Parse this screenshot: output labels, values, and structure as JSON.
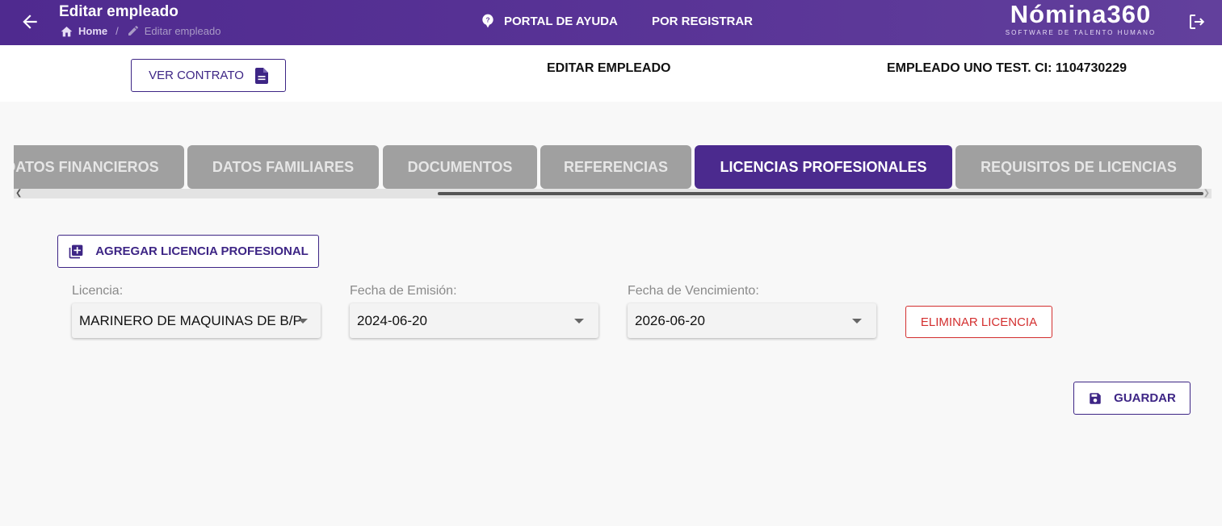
{
  "topbar": {
    "title": "Editar empleado",
    "breadcrumb": {
      "home": "Home",
      "current": "Editar empleado"
    },
    "nav_help": "PORTAL DE AYUDA",
    "nav_register": "POR REGISTRAR",
    "logo_main": "Nómina360",
    "logo_sub": "SOFTWARE DE TALENTO HUMANO"
  },
  "header": {
    "ver_contrato": "VER CONTRATO",
    "page_heading": "EDITAR EMPLEADO",
    "employee_info": "EMPLEADO UNO TEST. CI: 1104730229"
  },
  "tabs": [
    {
      "label": "DATOS FINANCIEROS",
      "active": false
    },
    {
      "label": "DATOS FAMILIARES",
      "active": false
    },
    {
      "label": "DOCUMENTOS",
      "active": false
    },
    {
      "label": "REFERENCIAS",
      "active": false
    },
    {
      "label": "LICENCIAS PROFESIONALES",
      "active": true
    },
    {
      "label": "REQUISITOS DE LICENCIAS",
      "active": false
    }
  ],
  "form": {
    "add_button": "AGREGAR LICENCIA PROFESIONAL",
    "licencia_label": "Licencia:",
    "licencia_value": "MARINERO DE MAQUINAS DE B/P",
    "emision_label": "Fecha de Emisión:",
    "emision_value": "2024-06-20",
    "vencimiento_label": "Fecha de Vencimiento:",
    "vencimiento_value": "2026-06-20",
    "delete_button": "ELIMINAR LICENCIA",
    "save_button": "GUARDAR"
  },
  "colors": {
    "primary": "#4b2a8e",
    "danger": "#d32f2f",
    "tab_inactive": "#a0a0a0"
  }
}
